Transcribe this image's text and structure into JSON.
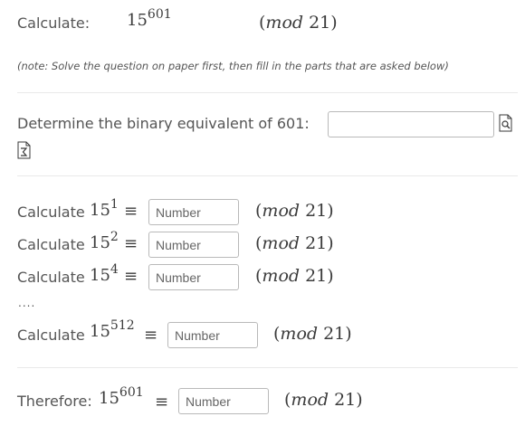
{
  "problem": {
    "label": "Calculate:",
    "base": "15",
    "exponent": "601",
    "mod_word": "mod",
    "mod_value": "21"
  },
  "note": "(note: Solve the question on paper first, then fill in the parts that are asked below)",
  "binary": {
    "label": "Determine the binary equivalent of 601:",
    "value": ""
  },
  "steps": [
    {
      "label": "Calculate",
      "base": "15",
      "exponent": "1",
      "placeholder": "Number",
      "mod_word": "mod",
      "mod_value": "21"
    },
    {
      "label": "Calculate",
      "base": "15",
      "exponent": "2",
      "placeholder": "Number",
      "mod_word": "mod",
      "mod_value": "21"
    },
    {
      "label": "Calculate",
      "base": "15",
      "exponent": "4",
      "placeholder": "Number",
      "mod_word": "mod",
      "mod_value": "21"
    },
    {
      "label": "Calculate",
      "base": "15",
      "exponent": "512",
      "placeholder": "Number",
      "mod_word": "mod",
      "mod_value": "21"
    }
  ],
  "ellipsis": "....",
  "equiv_symbol": "≡",
  "therefore": {
    "label": "Therefore:",
    "base": "15",
    "exponent": "601",
    "placeholder": "Number",
    "mod_word": "mod",
    "mod_value": "21"
  },
  "icons": [
    "preview-icon",
    "equation-editor-icon"
  ]
}
